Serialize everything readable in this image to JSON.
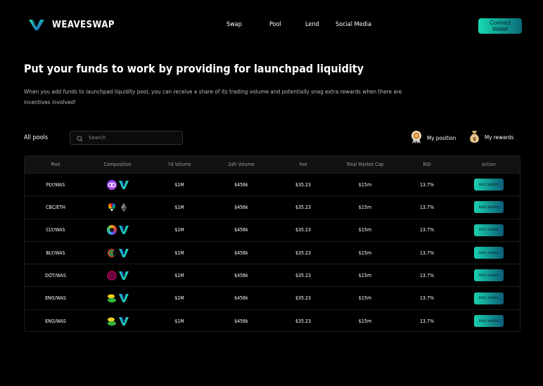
{
  "brand": {
    "name": "WEAVESWAP",
    "accent": "#18d9b0"
  },
  "nav": {
    "items": [
      "Swap",
      "Pool",
      "Lend",
      "Social Media"
    ],
    "connect_label": "Connect Wallet"
  },
  "hero": {
    "title": "Put your funds to work by providing for launchpad liquidity",
    "description": "When you add funds to launchpad liquidity pool, you can receive a share of its trading volume and potentially snag extra rewards when there are incentives involved!"
  },
  "toolbar": {
    "all_pools": "All pools",
    "search_placeholder": "Search",
    "my_position": "My position",
    "my_rewards": "My rewards"
  },
  "table": {
    "columns": [
      "Pool",
      "Composition",
      "7d Volume",
      "24h Volume",
      "Fee",
      "Total Market Cap",
      "ROI",
      "Action"
    ],
    "rows": [
      {
        "pool": "PLY/WAS",
        "icons": [
          "ply-token-icon",
          "weave-token-icon"
        ],
        "vol7d": "$1M",
        "vol24h": "$456k",
        "fee": "$35.23",
        "mcap": "$15m",
        "roi": "13.7%",
        "action": "Add Liquidity"
      },
      {
        "pool": "CBC/ETH",
        "icons": [
          "cbc-token-icon",
          "eth-token-icon"
        ],
        "vol7d": "$1M",
        "vol24h": "$456k",
        "fee": "$35.23",
        "mcap": "$15m",
        "roi": "13.7%",
        "action": "Add Liquidity"
      },
      {
        "pool": "CLY/WAS",
        "icons": [
          "cly-token-icon",
          "weave-token-icon"
        ],
        "vol7d": "$1M",
        "vol24h": "$456k",
        "fee": "$35.23",
        "mcap": "$15m",
        "roi": "13.7%",
        "action": "Add Liquidity"
      },
      {
        "pool": "BLY/WAS",
        "icons": [
          "bly-token-icon",
          "weave-token-icon"
        ],
        "vol7d": "$1M",
        "vol24h": "$456k",
        "fee": "$35.23",
        "mcap": "$15m",
        "roi": "13.7%",
        "action": "Add Liquidity"
      },
      {
        "pool": "DOT/WAS",
        "icons": [
          "dot-token-icon",
          "weave-token-icon"
        ],
        "vol7d": "$1M",
        "vol24h": "$456k",
        "fee": "$35.23",
        "mcap": "$15m",
        "roi": "13.7%",
        "action": "Add Liquidity"
      },
      {
        "pool": "ENG/WAS",
        "icons": [
          "eng-token-icon",
          "weave-token-icon"
        ],
        "vol7d": "$1M",
        "vol24h": "$456k",
        "fee": "$35.23",
        "mcap": "$15m",
        "roi": "13.7%",
        "action": "Add Liquidity"
      },
      {
        "pool": "ENG/WAS",
        "icons": [
          "eng-token-icon",
          "weave-token-icon"
        ],
        "vol7d": "$1M",
        "vol24h": "$456k",
        "fee": "$35.23",
        "mcap": "$15m",
        "roi": "13.7%",
        "action": "Add Liquidity"
      }
    ]
  }
}
